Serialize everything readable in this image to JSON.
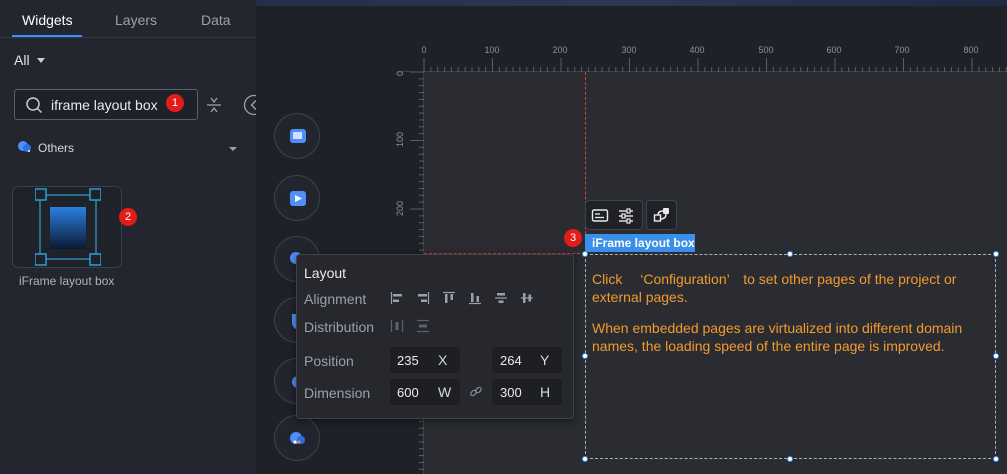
{
  "left_panel": {
    "tabs": [
      {
        "label": "Widgets",
        "active": true
      },
      {
        "label": "Layers",
        "active": false
      },
      {
        "label": "Data",
        "active": false
      }
    ],
    "filter": {
      "selected": "All"
    },
    "search": {
      "value": "iframe layout box"
    },
    "category": {
      "label": "Others",
      "icon": "cloud-icon"
    },
    "widgets": [
      {
        "label": "iFrame layout box",
        "icon": "iframe-layout-box-icon"
      }
    ]
  },
  "step_markers": [
    "1",
    "2",
    "3"
  ],
  "canvas": {
    "ruler_top": [
      "0",
      "100",
      "200",
      "300",
      "400",
      "500",
      "600",
      "700",
      "800"
    ],
    "ruler_left": [
      "0",
      "100",
      "200"
    ],
    "selected_widget": {
      "tag": "iFrame layout box",
      "text": [
        "Click 　‘Configuration’　to set other pages of the project or external pages.",
        "When embedded pages are virtualized into different domain names, the loading speed of the entire page is improved."
      ]
    }
  },
  "layout_panel": {
    "title": "Layout",
    "alignment_label": "Alignment",
    "distribution_label": "Distribution",
    "position": {
      "label": "Position",
      "x": "235",
      "x_unit": "X",
      "y": "264",
      "y_unit": "Y"
    },
    "dimension": {
      "label": "Dimension",
      "w": "600",
      "w_unit": "W",
      "h": "300",
      "h_unit": "H"
    }
  },
  "colors": {
    "accent": "#3a8fe8",
    "marker": "#e31b1b",
    "frame_text": "#f39a2f"
  }
}
